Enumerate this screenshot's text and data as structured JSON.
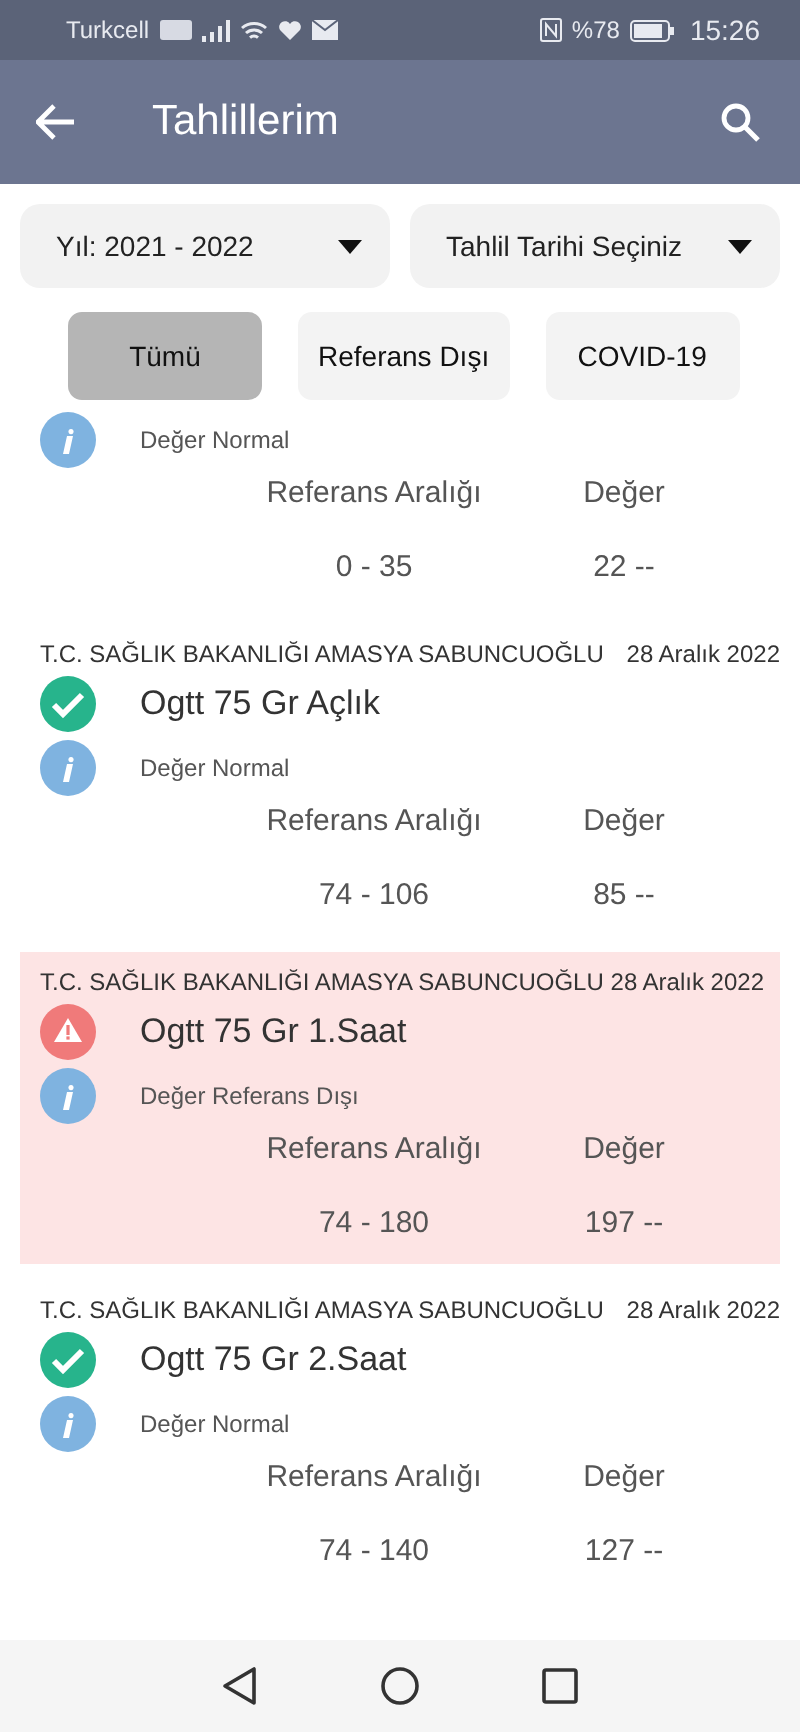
{
  "status_bar": {
    "carrier": "Turkcell",
    "battery": "%78",
    "time": "15:26"
  },
  "app_bar": {
    "title": "Tahlillerim"
  },
  "filters": [
    {
      "label": "Yıl: 2021 - 2022"
    },
    {
      "label": "Tahlil Tarihi Seçiniz"
    }
  ],
  "chips": [
    {
      "label": "Tümü",
      "selected": true
    },
    {
      "label": "Referans Dışı",
      "selected": false
    },
    {
      "label": "COVID-19",
      "selected": false
    }
  ],
  "results": [
    {
      "note": "Değer Normal",
      "range_label": "Referans Aralığı",
      "value_label": "Değer",
      "range": "0 - 35",
      "value": "22 --"
    },
    {
      "hospital": "T.C. SAĞLIK BAKANLIĞI AMASYA SABUNCUOĞLU",
      "date": "28 Aralık 2022",
      "kind": "normal",
      "name": "Ogtt 75 Gr Açlık",
      "note": "Değer Normal",
      "range_label": "Referans Aralığı",
      "value_label": "Değer",
      "range": "74 - 106",
      "value": "85 --"
    },
    {
      "hospital": "T.C. SAĞLIK BAKANLIĞI AMASYA SABUNCUOĞLU",
      "date": "28 Aralık 2022",
      "kind": "out",
      "name": "Ogtt 75 Gr 1.Saat",
      "note": "Değer Referans Dışı",
      "range_label": "Referans Aralığı",
      "value_label": "Değer",
      "range": "74 - 180",
      "value": "197 --"
    },
    {
      "hospital": "T.C. SAĞLIK BAKANLIĞI AMASYA SABUNCUOĞLU",
      "date": "28 Aralık 2022",
      "kind": "normal",
      "name": "Ogtt 75 Gr 2.Saat",
      "note": "Değer Normal",
      "range_label": "Referans Aralığı",
      "value_label": "Değer",
      "range": "74 - 140",
      "value": "127 --"
    }
  ]
}
